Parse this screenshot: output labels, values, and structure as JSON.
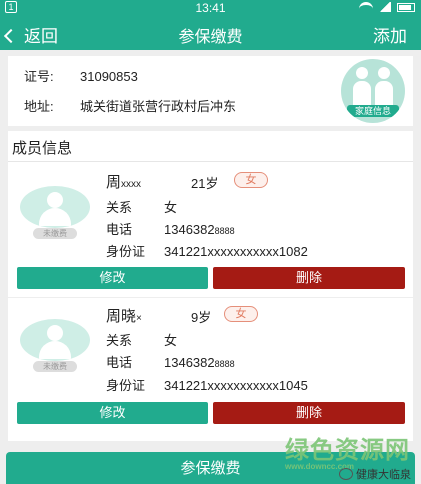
{
  "status_bar": {
    "left_badge": "1",
    "time": "13:41"
  },
  "nav": {
    "back": "返回",
    "title": "参保缴费",
    "add": "添加"
  },
  "family": {
    "id_label": "证号:",
    "id_value": "31090853",
    "addr_label": "地址:",
    "addr_value": "城关街道张营行政村后冲东",
    "icon_caption": "家庭信息"
  },
  "members_title": "成员信息",
  "members": [
    {
      "name": "周",
      "name_mask": "xxxx",
      "age": "21岁",
      "sex": "女",
      "status": "未缴费",
      "relation_label": "关系",
      "relation": "女",
      "phone_label": "电话",
      "phone": "1346382",
      "phone_mask": "8888",
      "id_label": "身份证",
      "id_card": "341221xxxxxxxxxxx1082",
      "edit": "修改",
      "delete": "删除"
    },
    {
      "name": "周晓",
      "name_mask": "×",
      "age": "9岁",
      "sex": "女",
      "status": "未缴费",
      "relation_label": "关系",
      "relation": "女",
      "phone_label": "电话",
      "phone": "1346382",
      "phone_mask": "8888",
      "id_label": "身份证",
      "id_card": "341221xxxxxxxxxxx1045",
      "edit": "修改",
      "delete": "删除"
    }
  ],
  "pay_button": "参保缴费",
  "watermark": {
    "site": "绿色资源网",
    "site_url": "www.downcc.com",
    "account": "健康大临泉"
  }
}
